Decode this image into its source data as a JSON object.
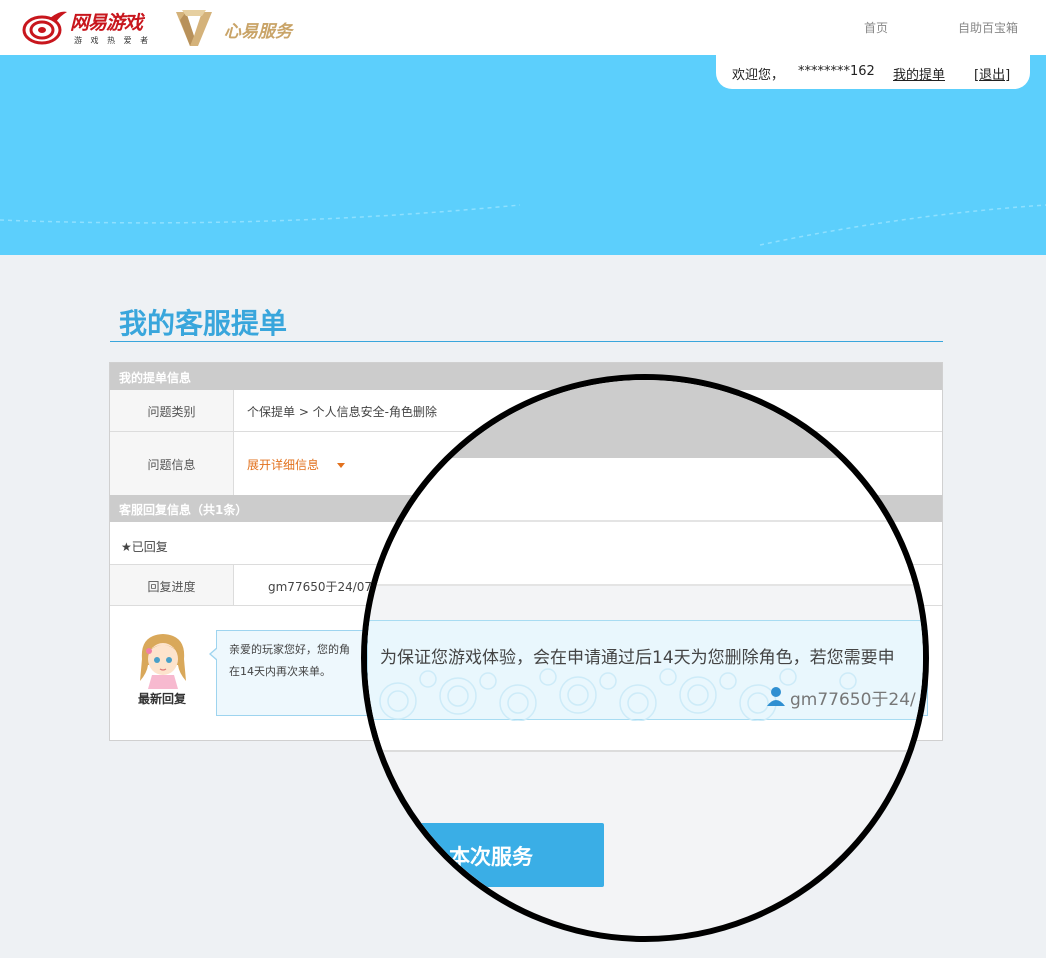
{
  "header": {
    "brand_name": "网易游戏",
    "brand_tagline": "游 戏 热 爱 者",
    "service_name": "心易服务",
    "nav": {
      "home": "首页",
      "self_help": "自助百宝箱"
    }
  },
  "user_bar": {
    "welcome": "欢迎您，",
    "username": "********162",
    "my_tickets": "我的提单",
    "logout": "[退出]"
  },
  "page_title": "我的客服提单",
  "ticket_info": {
    "section_title": "我的提单信息",
    "category_label": "问题类别",
    "category_value": "个保提单 > 个人信息安全-角色删除",
    "info_label": "问题信息",
    "expand_link": "展开详细信息"
  },
  "reply_info": {
    "section_title": "客服回复信息（共1条）",
    "status": "★已回复",
    "progress_label": "回复进度",
    "progress_value": "gm77650于24/07",
    "avatar_label": "最新回复",
    "reply_line1": "亲爱的玩家您好，您的角",
    "reply_line2": "在14天内再次来单。"
  },
  "magnifier": {
    "reply_text": "为保证您游戏体验，会在申请通过后14天为您删除角色，若您需要申",
    "author": "gm77650于24/",
    "button_label": "本次服务"
  },
  "colors": {
    "banner": "#5ccffc",
    "accent": "#39a6dc",
    "link_orange": "#e2711d",
    "button": "#3aaee6"
  },
  "icons": [
    "netease-logo-icon",
    "xinyi-logo-icon",
    "caret-down-icon",
    "person-icon"
  ]
}
